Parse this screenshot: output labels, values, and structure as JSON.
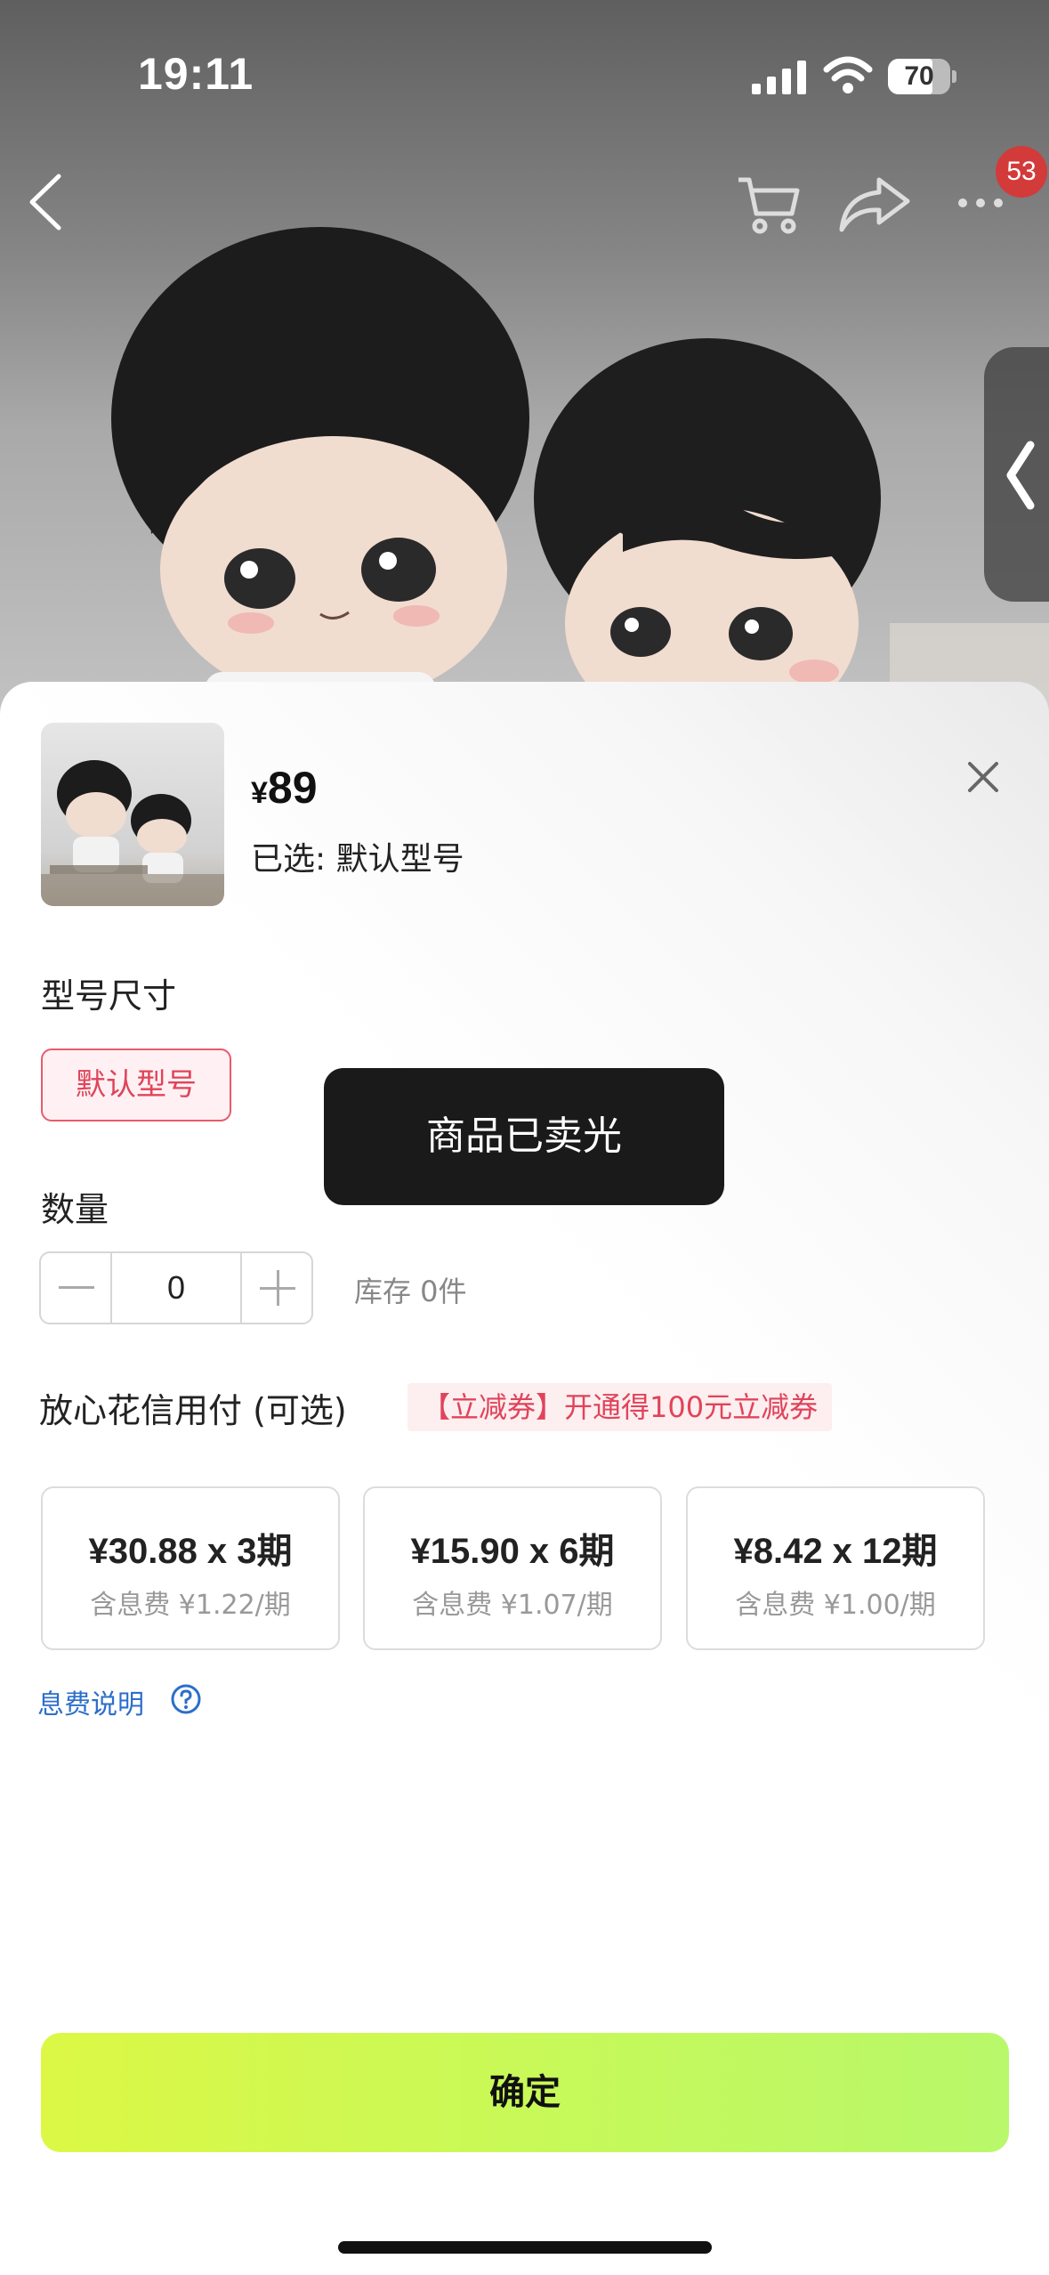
{
  "status_bar": {
    "time": "19:11",
    "battery": "70"
  },
  "nav": {
    "notification_count": "53"
  },
  "product": {
    "price_symbol": "¥",
    "price": "89",
    "selected_text": "已选: 默认型号"
  },
  "variants": {
    "section_title": "型号尺寸",
    "options": [
      {
        "label": "默认型号",
        "selected": true
      }
    ]
  },
  "toast": "商品已卖光",
  "quantity": {
    "section_title": "数量",
    "value": "0",
    "stock_text": "库存 0件"
  },
  "installment": {
    "title": "放心花信用付 (可选)",
    "promo": "【立减券】开通得100元立减券",
    "plans": [
      {
        "main": "¥30.88 x 3期",
        "sub": "含息费 ¥1.22/期"
      },
      {
        "main": "¥15.90 x 6期",
        "sub": "含息费 ¥1.07/期"
      },
      {
        "main": "¥8.42 x 12期",
        "sub": "含息费 ¥1.00/期"
      }
    ],
    "fee_link": "息费说明"
  },
  "confirm_label": "确定",
  "colors": {
    "accent_red": "#e0445a",
    "confirm_start": "#dcf845",
    "confirm_end": "#b8f86a",
    "link_blue": "#2c6ecb"
  }
}
